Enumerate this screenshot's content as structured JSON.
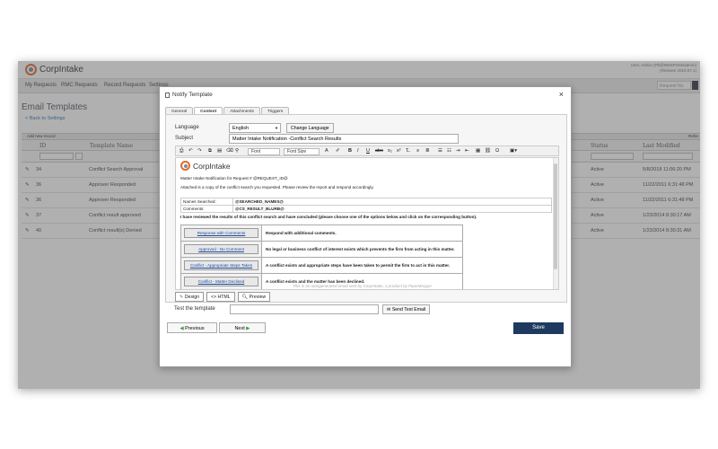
{
  "app": {
    "logo_text": "CorpIntake",
    "user_line1": "User, Admin (Pb@MDSPGMsadmin)",
    "user_line2": "(Release 2015.07.1)",
    "nav": [
      "My Requests",
      "RMC Requests",
      "Record Requests",
      "Settings"
    ],
    "request_placeholder": "Request No.",
    "page_title": "Email Templates",
    "back_link": "< Back to Settings",
    "add_record": "Add new record",
    "refresh": "Refre",
    "columns": [
      "ID",
      "Template Name",
      "Status",
      "Last Modified"
    ],
    "rows": [
      {
        "id": "34",
        "name": "Conflict Search Approval",
        "status": "Active",
        "modified": "5/8/2018 11:06:20 PM"
      },
      {
        "id": "36",
        "name": "Approver Responded",
        "status": "Active",
        "modified": "11/22/2011 6:31:48 PM"
      },
      {
        "id": "36",
        "name": "Approver Responded",
        "status": "Active",
        "modified": "11/22/2011 6:31:48 PM"
      },
      {
        "id": "37",
        "name": "Conflict result approved",
        "status": "Active",
        "modified": "1/23/2014 8:30:17 AM"
      },
      {
        "id": "40",
        "name": "Conflict result(s) Denied",
        "status": "Active",
        "modified": "1/23/2014 8:30:31 AM"
      }
    ]
  },
  "modal": {
    "title": "Notify Template",
    "close": "×",
    "tabs": [
      "General",
      "Content",
      "Attachments",
      "Triggers"
    ],
    "language_label": "Language",
    "language_value": "English",
    "change_language": "Change Language",
    "subject_label": "Subject",
    "subject_value": "Matter Intake Notification -Conflict Search Results",
    "toolbar": {
      "font": "Font",
      "font_size": "Font Size"
    },
    "editor": {
      "logo_text": "CorpIntake",
      "line1": "Matter Intake Notification for Request # @REQUEST_ID@",
      "line2": "Attached is a copy of the conflict search you requested. Please review the report and respond accordingly.",
      "names_label": "Names Searched:",
      "names_value": "@SEARCHED_NAMES@",
      "comments_label": "Comments:",
      "comments_value": "@CS_RESULT_BLURB@",
      "line3": "I have reviewed the results of this conflict search and have concluded (please choose one of the options below and click on the corresponding button).",
      "options": [
        {
          "button": "Response with Comments",
          "desc": "Respond with additional comments."
        },
        {
          "button": "Approved - No Comment",
          "desc": "No legal or business conflict of interest exists which prevents the firm from acting in this matter."
        },
        {
          "button": "Conflict - Appropriate Steps Taken",
          "desc": "A conflict exists and appropriate steps have been taken to permit the firm to act in this matter."
        },
        {
          "button": "Conflict - Matter Declined",
          "desc": "A conflict exists and the matter has been declined."
        }
      ],
      "footer": "This is an autogenerated email sent by CorpIntake, a product by PiperMorgan"
    },
    "modes": [
      "Design",
      "HTML",
      "Preview"
    ],
    "test_label": "Test the template",
    "send_test": "Send Test Email",
    "previous": "Previous",
    "next": "Next",
    "save": "Save"
  }
}
